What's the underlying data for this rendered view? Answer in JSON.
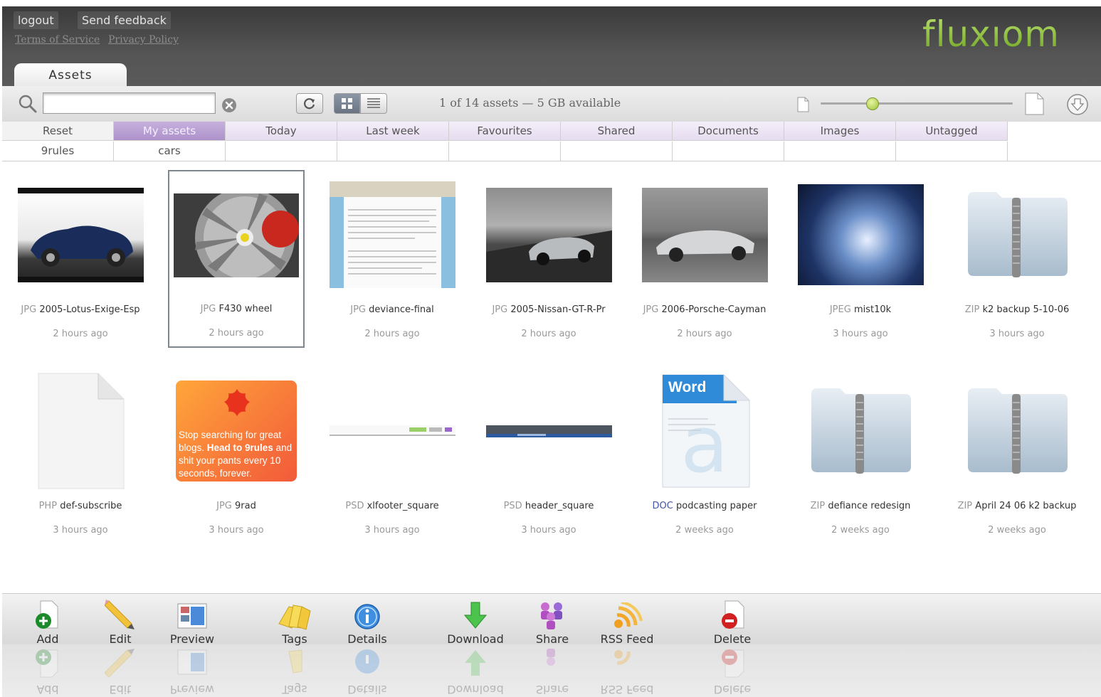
{
  "header": {
    "logout_label": "logout",
    "feedback_label": "Send feedback",
    "terms_label": "Terms of Service",
    "privacy_label": "Privacy Policy",
    "logo_text": "fluxıom",
    "tab_label": "Assets"
  },
  "toolbar": {
    "search_value": "",
    "status": "1 of 14 assets — 5 GB available",
    "zoom_level": 0.27
  },
  "filters": {
    "row1": [
      "Reset",
      "My assets",
      "Today",
      "Last week",
      "Favourites",
      "Shared",
      "Documents",
      "Images",
      "Untagged"
    ],
    "row2": [
      "9rules",
      "cars",
      "",
      "",
      "",
      "",
      "",
      "",
      ""
    ]
  },
  "assets": [
    {
      "type": "JPG",
      "name": "2005-Lotus-Exige-Esp",
      "time": "2 hours ago"
    },
    {
      "type": "JPG",
      "name": "F430 wheel",
      "time": "2 hours ago"
    },
    {
      "type": "JPG",
      "name": "deviance-final",
      "time": "2 hours ago"
    },
    {
      "type": "JPG",
      "name": "2005-Nissan-GT-R-Pr",
      "time": "2 hours ago"
    },
    {
      "type": "JPG",
      "name": "2006-Porsche-Cayman",
      "time": "2 hours ago"
    },
    {
      "type": "JPEG",
      "name": "mist10k",
      "time": "3 hours ago"
    },
    {
      "type": "ZIP",
      "name": "k2 backup 5-10-06",
      "time": "3 hours ago"
    },
    {
      "type": "PHP",
      "name": "def-subscribe",
      "time": "3 hours ago"
    },
    {
      "type": "JPG",
      "name": "9rad",
      "time": "3 hours ago"
    },
    {
      "type": "PSD",
      "name": "xlfooter_square",
      "time": "3 hours ago"
    },
    {
      "type": "PSD",
      "name": "header_square",
      "time": "3 hours ago"
    },
    {
      "type": "DOC",
      "name": "podcasting paper",
      "time": "2 weeks ago"
    },
    {
      "type": "ZIP",
      "name": "defiance redesign",
      "time": "2 weeks ago"
    },
    {
      "type": "ZIP",
      "name": "April 24 06 k2 backup",
      "time": "2 weeks ago"
    }
  ],
  "thumbnails": {
    "9rad_text": "Stop searching for great blogs. Head to 9rules and shit your pants every 10 seconds, forever.",
    "9rad_bold": "Head to 9rules",
    "word_label": "Word"
  },
  "actions": [
    {
      "label": "Add",
      "icon": "add-icon"
    },
    {
      "label": "Edit",
      "icon": "pencil-icon"
    },
    {
      "label": "Preview",
      "icon": "preview-icon"
    },
    {
      "label": "Tags",
      "icon": "tags-icon"
    },
    {
      "label": "Details",
      "icon": "info-icon"
    },
    {
      "label": "Download",
      "icon": "download-arrow-icon"
    },
    {
      "label": "Share",
      "icon": "share-people-icon"
    },
    {
      "label": "RSS Feed",
      "icon": "rss-icon"
    },
    {
      "label": "Delete",
      "icon": "delete-icon"
    }
  ],
  "colors": {
    "filter_active": "#b59bd2",
    "logo_green": "#8bc34a",
    "header_bg": "#4a4a4a"
  }
}
